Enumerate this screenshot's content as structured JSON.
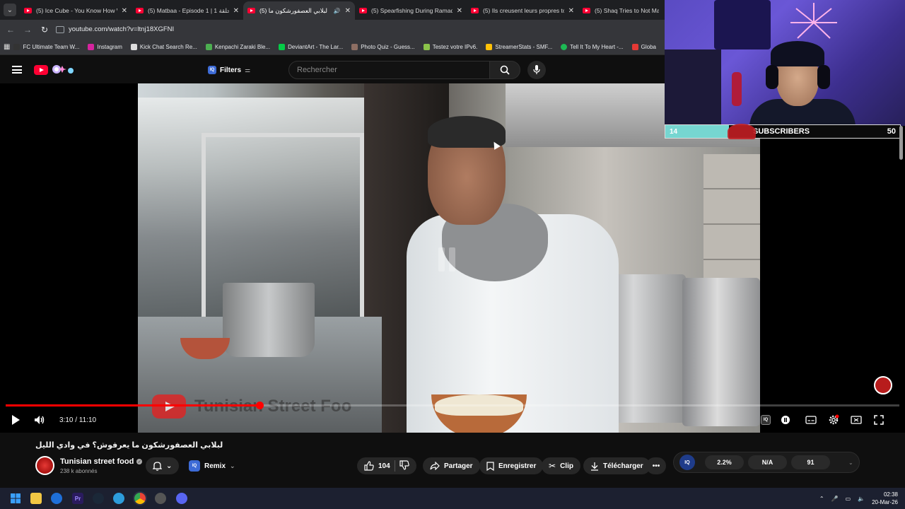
{
  "browser": {
    "tabs": [
      {
        "title": "(5) Ice Cube - You Know How W",
        "active": false,
        "audio": false
      },
      {
        "title": "(5) Matbaa - Episode 1 | الحلقة 1",
        "active": false,
        "audio": false
      },
      {
        "title": "(5) لبلابي العصفورشكون ما",
        "active": true,
        "audio": true
      },
      {
        "title": "(5) Spearfishing During Ramad",
        "active": false,
        "audio": false
      },
      {
        "title": "(5) Ils creusent leurs propres to",
        "active": false,
        "audio": false
      },
      {
        "title": "(5) Shaq Tries to Not Make",
        "active": false,
        "audio": false
      }
    ],
    "url": "youtube.com/watch?v=ltnj18XGFNI",
    "bookmarks": [
      {
        "label": "FC Ultimate Team W...",
        "color": "#333333"
      },
      {
        "label": "Instagram",
        "color": "#d6249f"
      },
      {
        "label": "Kick Chat Search Re...",
        "color": "#dddddd"
      },
      {
        "label": "Kenpachi Zaraki Ble...",
        "color": "#4caf50"
      },
      {
        "label": "DeviantArt - The Lar...",
        "color": "#05cc47"
      },
      {
        "label": "Photo Quiz - Guess...",
        "color": "#8d6e63"
      },
      {
        "label": "Testez votre IPv6.",
        "color": "#8bc34a"
      },
      {
        "label": "StreamerStats - SMF...",
        "color": "#ffc107"
      },
      {
        "label": "Tell It To My Heart -...",
        "color": "#1db954"
      },
      {
        "label": "Globa",
        "color": "#e53935"
      }
    ]
  },
  "youtube": {
    "filters_label": "Filters",
    "search_placeholder": "Rechercher",
    "player": {
      "time": "3:10 / 11:10",
      "progress_fraction": 0.284,
      "watermark": "Tunisian Street Foo"
    },
    "video": {
      "title": "لبلابي العصفورشكون ما يعرفوش؟ في وادي الليل",
      "channel": "Tunisian street food",
      "subscribers": "238 k abonnés",
      "remix": "Remix",
      "likes": "104",
      "share": "Partager",
      "save": "Enregistrer",
      "clip": "Clip",
      "download": "Télécharger"
    },
    "extension_stats": {
      "badge": "IQ",
      "values": [
        "2.2%",
        "N/A",
        "91"
      ]
    }
  },
  "stream_overlay": {
    "sub_count": "14",
    "sub_label": "SUBSCRIBERS",
    "sub_goal": "50",
    "accent": "#76d6d1"
  },
  "taskbar": {
    "time": "02:38",
    "date": "20-Mar-26"
  }
}
